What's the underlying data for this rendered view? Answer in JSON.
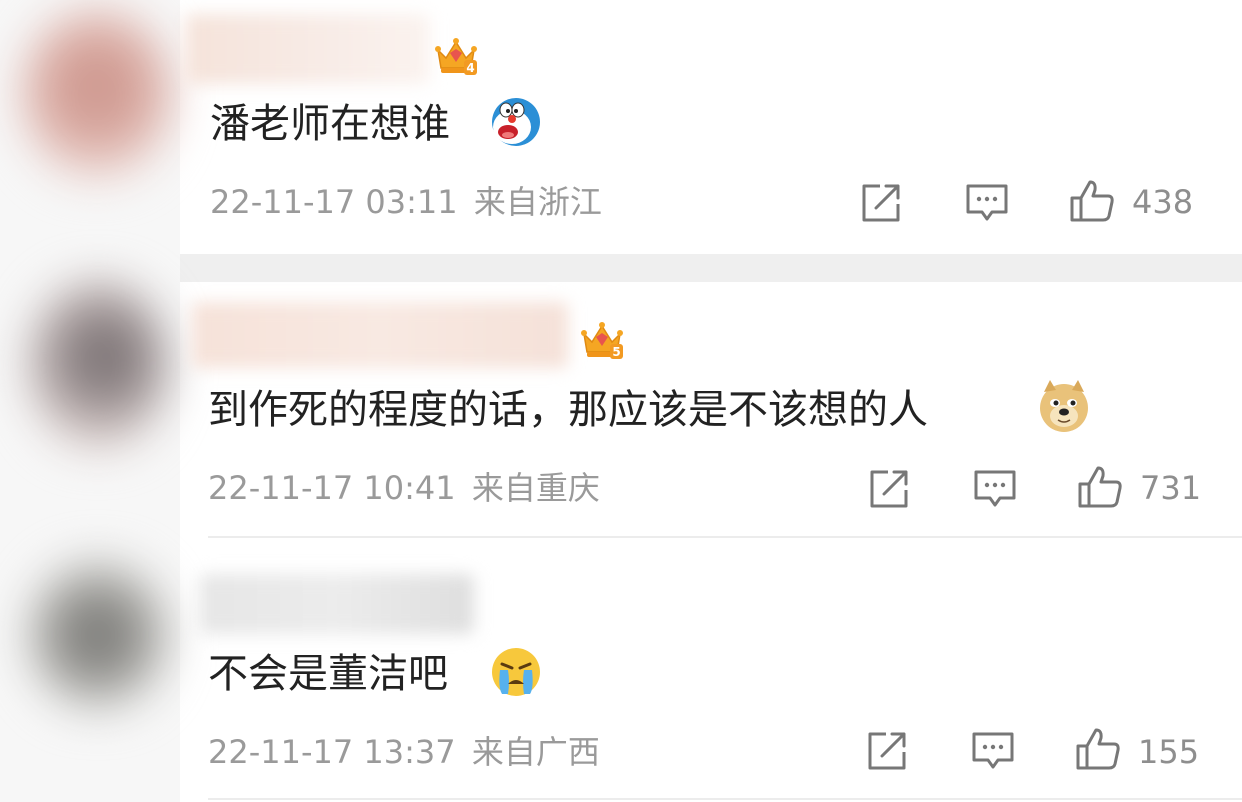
{
  "comments": [
    {
      "level": "4",
      "text": "潘老师在想谁",
      "emoji": "doraemon-emoji",
      "timestamp": "22-11-17 03:11",
      "location": "来自浙江",
      "likes": "438"
    },
    {
      "level": "5",
      "text": "到作死的程度的话，那应该是不该想的人",
      "emoji": "doge-emoji",
      "timestamp": "22-11-17 10:41",
      "location": "来自重庆",
      "likes": "731"
    },
    {
      "text": "不会是董洁吧",
      "emoji": "crying-emoji",
      "timestamp": "22-11-17 13:37",
      "location": "来自广西",
      "likes": "155"
    }
  ],
  "colors": {
    "text": "#222222",
    "meta": "#9a9a9a",
    "crown": "#f5a623",
    "gem": "#e8554e"
  }
}
